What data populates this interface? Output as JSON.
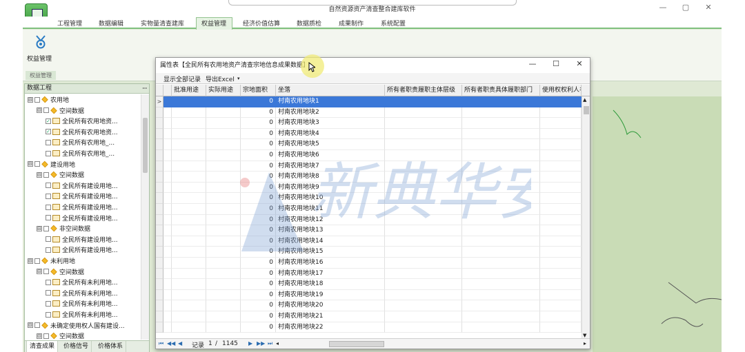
{
  "window": {
    "title": "自然资源资产清查整合建库软件",
    "controls": [
      "—",
      "▢",
      "✕"
    ]
  },
  "menu": {
    "items": [
      "工程管理",
      "数据编辑",
      "实物量清查建库",
      "权益管理",
      "经济价值估算",
      "数据质检",
      "成果制作",
      "系统配置"
    ],
    "active": "权益管理"
  },
  "ribbon": {
    "button_label": "权益管理",
    "group_label": "权益管理"
  },
  "left_panel": {
    "title": "数据工程",
    "pin": "ꟷ",
    "tree": [
      {
        "level": 1,
        "toggle": "⊟",
        "icon": "folder",
        "label": "农用地"
      },
      {
        "level": 2,
        "toggle": "⊟",
        "icon": "folder",
        "label": "空间数据"
      },
      {
        "level": 3,
        "check": "✓",
        "icon": "layer",
        "label": "全民所有农用地资..."
      },
      {
        "level": 3,
        "check": "✓",
        "icon": "layer",
        "label": "全民所有农用地资..."
      },
      {
        "level": 3,
        "check": "",
        "icon": "layer",
        "label": "全民所有农用地_..."
      },
      {
        "level": 3,
        "check": "",
        "icon": "layer",
        "label": "全民所有农用地_..."
      },
      {
        "level": 1,
        "toggle": "⊟",
        "icon": "folder",
        "label": "建设用地"
      },
      {
        "level": 2,
        "toggle": "⊟",
        "icon": "folder",
        "label": "空间数据"
      },
      {
        "level": 3,
        "check": "",
        "icon": "layer",
        "label": "全民所有建设用地..."
      },
      {
        "level": 3,
        "check": "",
        "icon": "layer",
        "label": "全民所有建设用地..."
      },
      {
        "level": 3,
        "check": "",
        "icon": "layer",
        "label": "全民所有建设用地..."
      },
      {
        "level": 3,
        "check": "",
        "icon": "layer",
        "label": "全民所有建设用地..."
      },
      {
        "level": 2,
        "toggle": "⊟",
        "icon": "folder",
        "label": "非空间数据"
      },
      {
        "level": 3,
        "check": "",
        "icon": "layer",
        "label": "全民所有建设用地..."
      },
      {
        "level": 3,
        "check": "",
        "icon": "layer",
        "label": "全民所有建设用地..."
      },
      {
        "level": 1,
        "toggle": "⊟",
        "icon": "folder",
        "label": "未利用地"
      },
      {
        "level": 2,
        "toggle": "⊟",
        "icon": "folder",
        "label": "空间数据"
      },
      {
        "level": 3,
        "check": "",
        "icon": "layer",
        "label": "全民所有未利用地..."
      },
      {
        "level": 3,
        "check": "",
        "icon": "layer",
        "label": "全民所有未利用地..."
      },
      {
        "level": 3,
        "check": "",
        "icon": "layer",
        "label": "全民所有未利用地..."
      },
      {
        "level": 3,
        "check": "",
        "icon": "layer",
        "label": "全民所有未利用地..."
      },
      {
        "level": 1,
        "toggle": "⊟",
        "icon": "folder",
        "label": "未确定使用权人国有建设..."
      },
      {
        "level": 2,
        "toggle": "⊟",
        "icon": "folder",
        "label": "空间数据"
      }
    ],
    "tabs": [
      "清查成果",
      "价格信号",
      "价格体系"
    ],
    "active_tab": "清查成果"
  },
  "dialog": {
    "title": "属性表【全民所有农用地资产清查宗地信息成果数据】",
    "controls": [
      "—",
      "☐",
      "✕"
    ],
    "toolbar": {
      "show_all": "显示全部记录",
      "export": "导出Excel",
      "dropdown": "▾"
    },
    "columns": [
      "批准用途",
      "实际用途",
      "宗地面积",
      "坐落",
      "所有者职责履职主体层级",
      "所有者职责具体履职部门",
      "使用权权利人名称"
    ],
    "rows": [
      {
        "area": "0",
        "location": "村南农用地块1"
      },
      {
        "area": "0",
        "location": "村南农用地块2"
      },
      {
        "area": "0",
        "location": "村南农用地块3"
      },
      {
        "area": "0",
        "location": "村南农用地块4"
      },
      {
        "area": "0",
        "location": "村南农用地块5"
      },
      {
        "area": "0",
        "location": "村南农用地块6"
      },
      {
        "area": "0",
        "location": "村南农用地块7"
      },
      {
        "area": "0",
        "location": "村南农用地块8"
      },
      {
        "area": "0",
        "location": "村南农用地块9"
      },
      {
        "area": "0",
        "location": "村南农用地块10"
      },
      {
        "area": "0",
        "location": "村南农用地块11"
      },
      {
        "area": "0",
        "location": "村南农用地块12"
      },
      {
        "area": "0",
        "location": "村南农用地块13"
      },
      {
        "area": "0",
        "location": "村南农用地块14"
      },
      {
        "area": "0",
        "location": "村南农用地块15"
      },
      {
        "area": "0",
        "location": "村南农用地块16"
      },
      {
        "area": "0",
        "location": "村南农用地块17"
      },
      {
        "area": "0",
        "location": "村南农用地块18"
      },
      {
        "area": "0",
        "location": "村南农用地块19"
      },
      {
        "area": "0",
        "location": "村南农用地块20"
      },
      {
        "area": "0",
        "location": "村南农用地块21"
      },
      {
        "area": "0",
        "location": "村南农用地块22"
      }
    ],
    "selected_row": 0,
    "current_row_marker": ">",
    "status": {
      "record_label": "记录",
      "current": "1",
      "separator": "/",
      "total": "1145",
      "nav_first": "⏮",
      "nav_prev": "◀◀",
      "nav_back": "◀",
      "nav_next": "▶",
      "nav_next_page": "▶▶",
      "nav_last": "⏭"
    }
  },
  "watermark": {
    "text": "新典华安"
  },
  "colors": {
    "accent": "#7fc07d",
    "selection": "#3b78d8",
    "map": "#c9dcb6"
  }
}
